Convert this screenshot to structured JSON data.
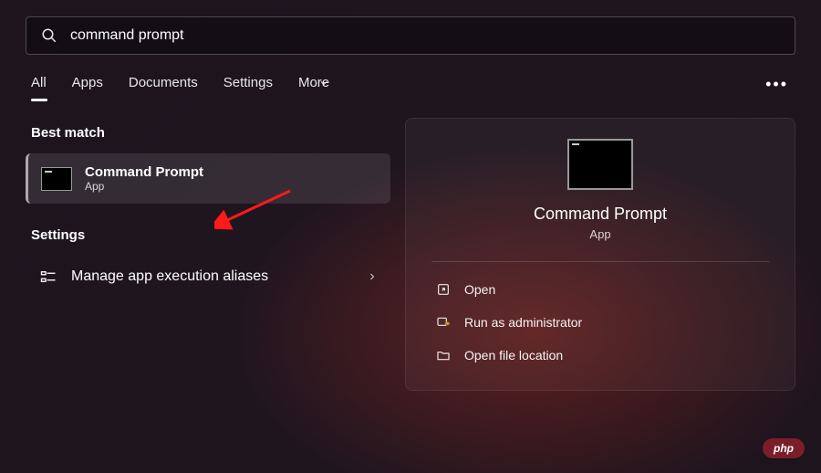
{
  "search": {
    "value": "command prompt"
  },
  "tabs": {
    "all": "All",
    "apps": "Apps",
    "documents": "Documents",
    "settings": "Settings",
    "more": "More"
  },
  "sections": {
    "best_match": "Best match",
    "settings": "Settings"
  },
  "best_match_result": {
    "title": "Command Prompt",
    "subtitle": "App"
  },
  "settings_items": [
    {
      "label": "Manage app execution aliases"
    }
  ],
  "detail": {
    "title": "Command Prompt",
    "subtitle": "App",
    "actions": {
      "open": "Open",
      "run_admin": "Run as administrator",
      "open_location": "Open file location"
    }
  },
  "badge": "php"
}
